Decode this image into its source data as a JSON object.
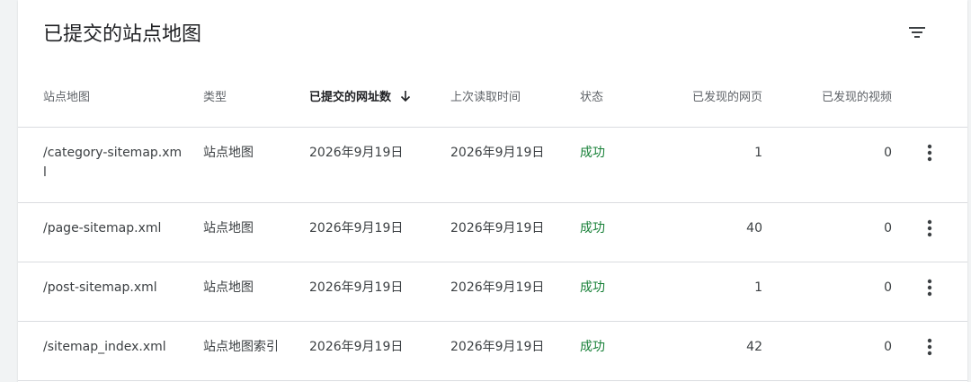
{
  "card": {
    "title": "已提交的站点地图",
    "filter_icon": "filter-icon"
  },
  "columns": {
    "sitemap": "站点地图",
    "type": "类型",
    "submitted": "已提交的网址数",
    "last_read": "上次读取时间",
    "status": "状态",
    "discovered_pages": "已发现的网页",
    "discovered_videos": "已发现的视频"
  },
  "sort": {
    "column": "submitted",
    "direction": "descending",
    "icon": "arrow-down-icon"
  },
  "rows": [
    {
      "sitemap": "/category-sitemap.xm",
      "sitemap_wrap": "l",
      "type": "站点地图",
      "submitted": "2026年9月19日",
      "last_read": "2026年9月19日",
      "status": "成功",
      "pages": "1",
      "videos": "0"
    },
    {
      "sitemap": "/page-sitemap.xml",
      "type": "站点地图",
      "submitted": "2026年9月19日",
      "last_read": "2026年9月19日",
      "status": "成功",
      "pages": "40",
      "videos": "0"
    },
    {
      "sitemap": "/post-sitemap.xml",
      "type": "站点地图",
      "submitted": "2026年9月19日",
      "last_read": "2026年9月19日",
      "status": "成功",
      "pages": "1",
      "videos": "0"
    },
    {
      "sitemap": "/sitemap_index.xml",
      "type": "站点地图索引",
      "submitted": "2026年9月19日",
      "last_read": "2026年9月19日",
      "status": "成功",
      "pages": "42",
      "videos": "0"
    }
  ],
  "colors": {
    "status_success": "#188038",
    "text_primary": "#202124",
    "text_secondary": "#5f6368",
    "divider": "#dadce0"
  }
}
